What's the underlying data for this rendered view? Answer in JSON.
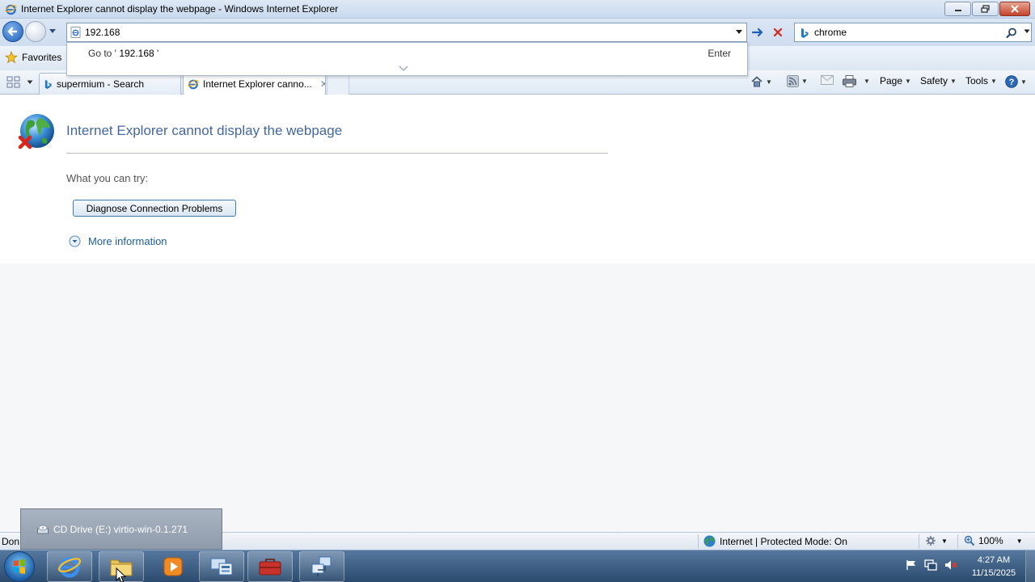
{
  "window": {
    "title": "Internet Explorer cannot display the webpage - Windows Internet Explorer"
  },
  "nav": {
    "address_value": "192.168",
    "search_value": "chrome"
  },
  "autocomplete": {
    "goto_prefix": "Go to '",
    "goto_query": " 192.168",
    "goto_suffix": " '",
    "enter_label": "Enter"
  },
  "favorites": {
    "label": "Favorites"
  },
  "tabs": [
    {
      "label": "supermium - Search",
      "active": false
    },
    {
      "label": "Internet Explorer canno...",
      "active": true
    }
  ],
  "commands": {
    "page": "Page",
    "safety": "Safety",
    "tools": "Tools"
  },
  "content": {
    "title": "Internet Explorer cannot display the webpage",
    "try_label": "What you can try:",
    "diagnose_button": "Diagnose Connection Problems",
    "more_info": "More information"
  },
  "status": {
    "text": "Don",
    "zone": "Internet | Protected Mode: On",
    "zoom": "100%"
  },
  "notification": {
    "text": "CD Drive (E:) virtio-win-0.1.271"
  },
  "taskbar": {
    "time": "4:27 AM",
    "date": "11/15/2025"
  },
  "colors": {
    "title_text": "#4467a3",
    "link": "#1c5f99",
    "stop_red": "#d0281b"
  }
}
